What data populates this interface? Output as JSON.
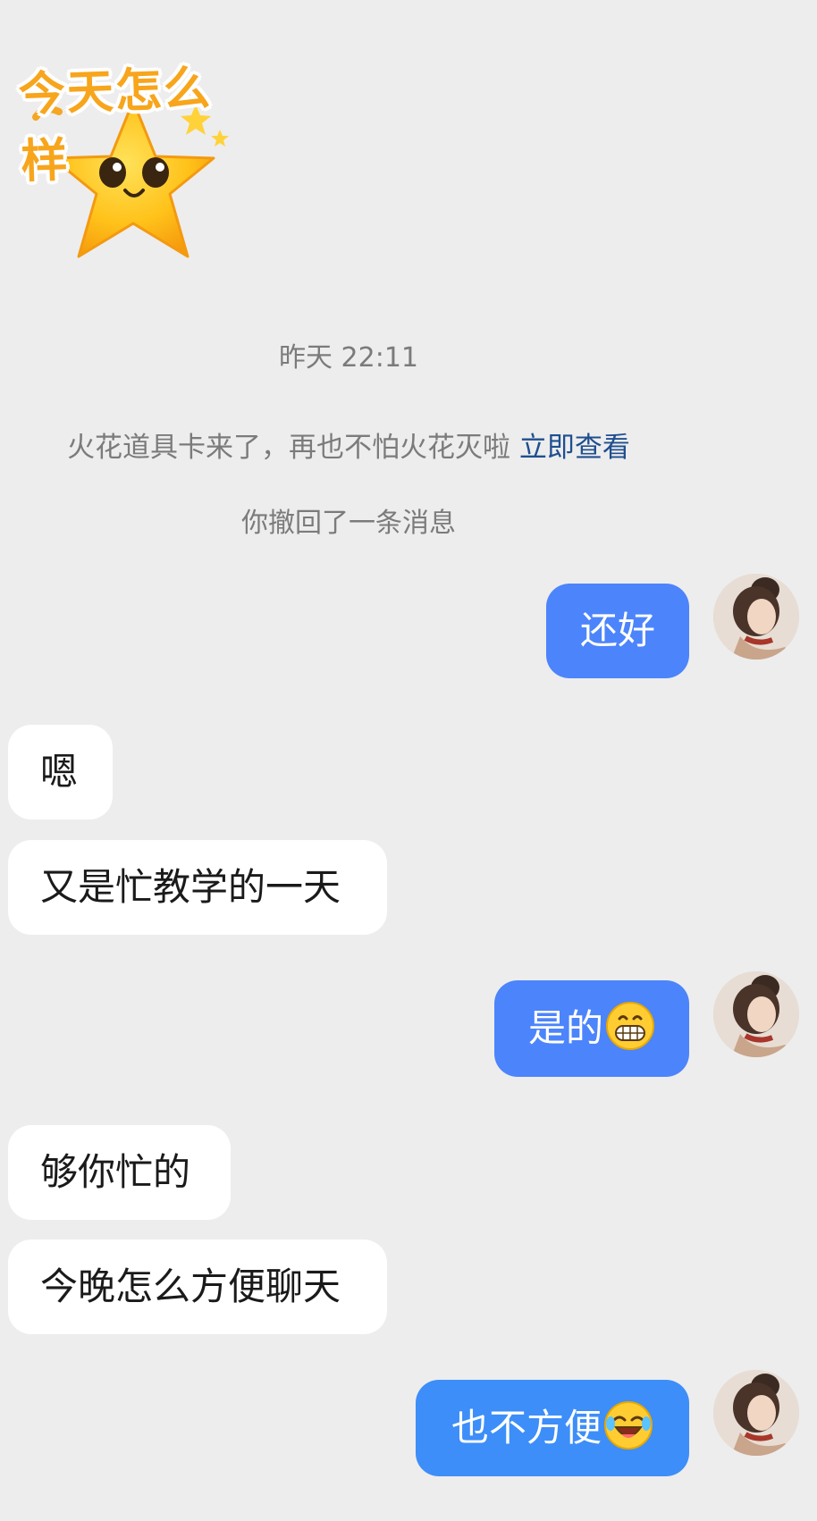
{
  "sticker": {
    "caption": "今天怎么样"
  },
  "timestamp": "昨天 22:11",
  "system_notice": {
    "text": "火花道具卡来了，再也不怕火花灭啦 ",
    "link": "立即查看"
  },
  "recall_notice": "你撤回了一条消息",
  "messages": [
    {
      "side": "out",
      "text": "还好"
    },
    {
      "side": "in",
      "text": "嗯"
    },
    {
      "side": "in",
      "text": "又是忙教学的一天"
    },
    {
      "side": "out",
      "text": "是的",
      "emoji": "grinning-face-icon"
    },
    {
      "side": "in",
      "text": "够你忙的"
    },
    {
      "side": "in",
      "text": "今晚怎么方便聊天"
    },
    {
      "side": "out",
      "text": "也不方便",
      "emoji": "rolling-laughing-face-icon"
    }
  ],
  "colors": {
    "background": "#ededed",
    "outgoing_bubble": "#4c84fb",
    "incoming_bubble": "#ffffff",
    "link": "#1f4f8f"
  }
}
